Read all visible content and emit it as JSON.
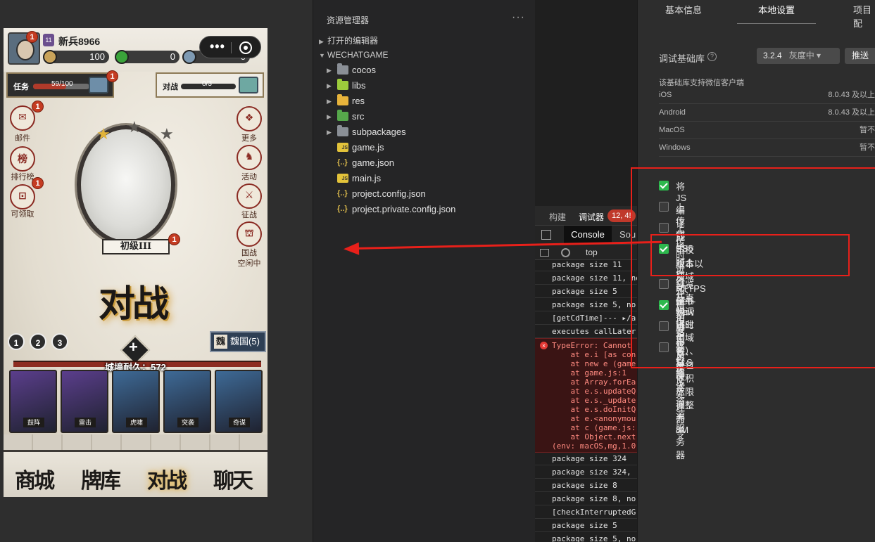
{
  "game": {
    "player_name": "新兵8966",
    "rank_icon": "11",
    "currency": [
      {
        "icon": "coin-icon",
        "value": "100",
        "color": "#c9a35a"
      },
      {
        "icon": "jade-icon",
        "value": "0",
        "color": "#3aa33a"
      },
      {
        "icon": "globe-icon",
        "value": "0",
        "color": "#7e9ab3"
      }
    ],
    "badge_count": "1",
    "task": {
      "label": "任务",
      "value": "59/100",
      "progress": 0.59
    },
    "battle_task": {
      "label": "对战",
      "value": "0/3",
      "progress": 0
    },
    "left_buttons": [
      {
        "label": "邮件",
        "icon": "mail-icon",
        "glyph": "✉"
      },
      {
        "label": "排行榜",
        "icon": "leaderboard-icon",
        "glyph": "榜"
      },
      {
        "label": "可领取",
        "icon": "claim-icon",
        "glyph": "⊡"
      }
    ],
    "right_buttons": [
      {
        "label": "更多",
        "icon": "more-icon",
        "glyph": "❖"
      },
      {
        "label": "活动",
        "icon": "event-icon",
        "glyph": "♞"
      },
      {
        "label": "征战",
        "icon": "campaign-icon",
        "glyph": "⚔"
      },
      {
        "label": "国战",
        "icon": "nation-war-icon",
        "glyph": "⛫"
      }
    ],
    "nation_war_status": "空闲中",
    "level_name": "初级III",
    "battle_title": "对战",
    "tiers": [
      "1",
      "2",
      "3"
    ],
    "nation": {
      "short": "魏",
      "label": "魏国(5)"
    },
    "wall_label": "城墙耐久：572",
    "cards": [
      {
        "name": "鼓阵",
        "color": "#5b3e8c"
      },
      {
        "name": "雷击",
        "color": "#5b3e8c"
      },
      {
        "name": "虎啸",
        "color": "#3e6a96"
      },
      {
        "name": "突袭",
        "color": "#3e6a96"
      },
      {
        "name": "奇谋",
        "color": "#3e6a96"
      }
    ],
    "nav": [
      "商城",
      "牌库",
      "对战",
      "聊天"
    ],
    "nav_active": 2
  },
  "capsule": {
    "more": "•••"
  },
  "explorer": {
    "title": "资源管理器",
    "more": "···",
    "open_editors": "打开的编辑器",
    "project": "WECHATGAME",
    "items": [
      {
        "name": "cocos",
        "type": "folder"
      },
      {
        "name": "libs",
        "type": "folder-libs"
      },
      {
        "name": "res",
        "type": "folder-res"
      },
      {
        "name": "src",
        "type": "folder-src"
      },
      {
        "name": "subpackages",
        "type": "folder"
      },
      {
        "name": "game.js",
        "type": "js"
      },
      {
        "name": "game.json",
        "type": "json"
      },
      {
        "name": "main.js",
        "type": "js"
      },
      {
        "name": "project.config.json",
        "type": "json"
      },
      {
        "name": "project.private.config.json",
        "type": "json"
      }
    ]
  },
  "debugger": {
    "tabs": [
      "构建",
      "调试器"
    ],
    "error_badge": "12, 4!",
    "console_tab": "Console",
    "sources_tab": "Sou",
    "context": "top",
    "logs_top": [
      "package size 11",
      "package size 11, no",
      "package size 5",
      "package size 5, no",
      "[getCdTime]--- ▸/a",
      "executes callLater"
    ],
    "error": "TypeError: Cannot\n    at e.i [as con\n    at new e (game\n    at game.js:1\n    at Array.forEa\n    at e.s.updateQ\n    at e.s._update\n    at e.s.doInitQ\n    at e.<anonymou\n    at c (game.js:\n    at Object.next\n(env: macOS,mg,1.0",
    "logs_bottom": [
      "package size 324",
      "package size 324,",
      "package size 8",
      "package size 8, no",
      "[checkInterruptedG",
      "package size 5",
      "package size 5, no"
    ]
  },
  "details": {
    "tabs": [
      "基本信息",
      "本地设置",
      "项目配"
    ],
    "active_tab": 1,
    "base_lib_label": "调试基础库",
    "base_lib_version": "3.2.4",
    "base_lib_channel": "灰度中 ▾",
    "push_button": "推送",
    "support_note": "该基础库支持微信客户端",
    "os_support": [
      {
        "os": "iOS",
        "value": "8.0.43 及以上"
      },
      {
        "os": "Android",
        "value": "8.0.43 及以上"
      },
      {
        "os": "MacOS",
        "value": "暂不"
      },
      {
        "os": "Windows",
        "value": "暂不"
      }
    ],
    "options": [
      {
        "label": "将 JS 编译成 ES5",
        "checked": true
      },
      {
        "label": "上传代码时自动压缩脚本文件",
        "checked": false
      },
      {
        "label": "上传时进行代码保护",
        "checked": false
      },
      {
        "label": "不校验合法域名、web-view（业务域名）、TLS",
        "label2": "版本以及 HTTPS 证书",
        "checked": true
      },
      {
        "label": "预览及真机调试时主包、分包体积上限调整为8M",
        "checked": false
      },
      {
        "label": "启用多核心编译",
        "checked": true
      },
      {
        "label": "启用自定义处理命令",
        "checked": false
      },
      {
        "label": "开启静态资源服务器",
        "checked": false
      }
    ],
    "annotation_color": "#e8201a"
  }
}
